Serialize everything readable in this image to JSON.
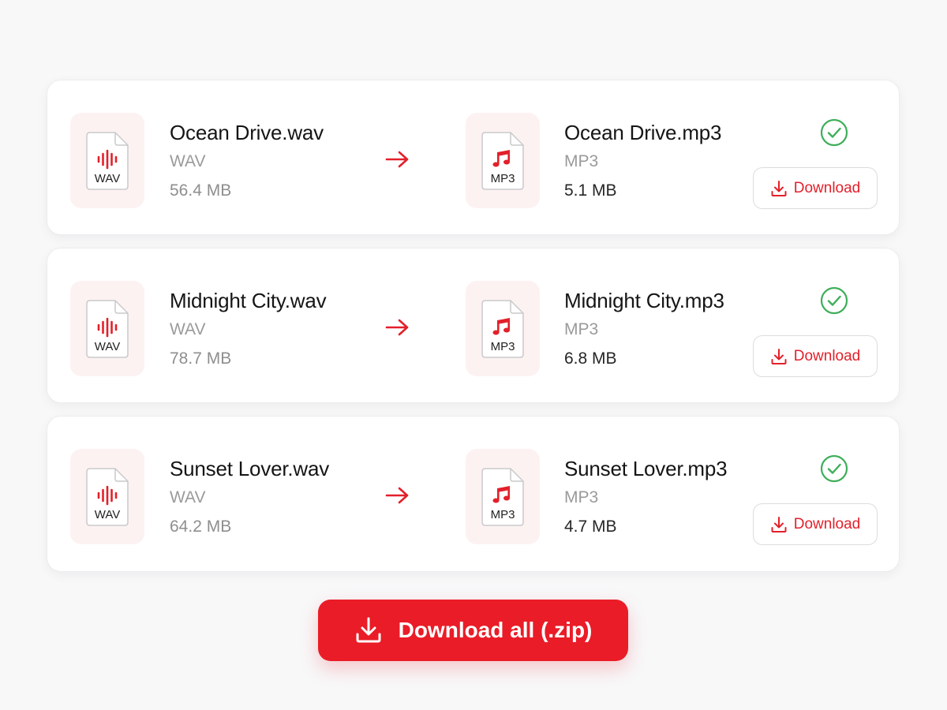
{
  "files": [
    {
      "source": {
        "name": "Ocean Drive.wav",
        "type": "WAV",
        "size": "56.4 MB",
        "icon_label": "WAV",
        "icon": "audio-waveform-file-icon"
      },
      "output": {
        "name": "Ocean Drive.mp3",
        "type": "MP3",
        "size": "5.1 MB",
        "icon_label": "MP3",
        "icon": "music-note-file-icon"
      },
      "status": "complete",
      "download_label": "Download"
    },
    {
      "source": {
        "name": "Midnight City.wav",
        "type": "WAV",
        "size": "78.7 MB",
        "icon_label": "WAV",
        "icon": "audio-waveform-file-icon"
      },
      "output": {
        "name": "Midnight City.mp3",
        "type": "MP3",
        "size": "6.8 MB",
        "icon_label": "MP3",
        "icon": "music-note-file-icon"
      },
      "status": "complete",
      "download_label": "Download"
    },
    {
      "source": {
        "name": "Sunset Lover.wav",
        "type": "WAV",
        "size": "64.2 MB",
        "icon_label": "WAV",
        "icon": "audio-waveform-file-icon"
      },
      "output": {
        "name": "Sunset Lover.mp3",
        "type": "MP3",
        "size": "4.7 MB",
        "icon_label": "MP3",
        "icon": "music-note-file-icon"
      },
      "status": "complete",
      "download_label": "Download"
    }
  ],
  "download_all_label": "Download all (.zip)",
  "colors": {
    "accent": "#ea1c27",
    "success": "#3fae5a",
    "tile_background": "#fdf2f2",
    "muted_text": "#9a9a9a"
  }
}
